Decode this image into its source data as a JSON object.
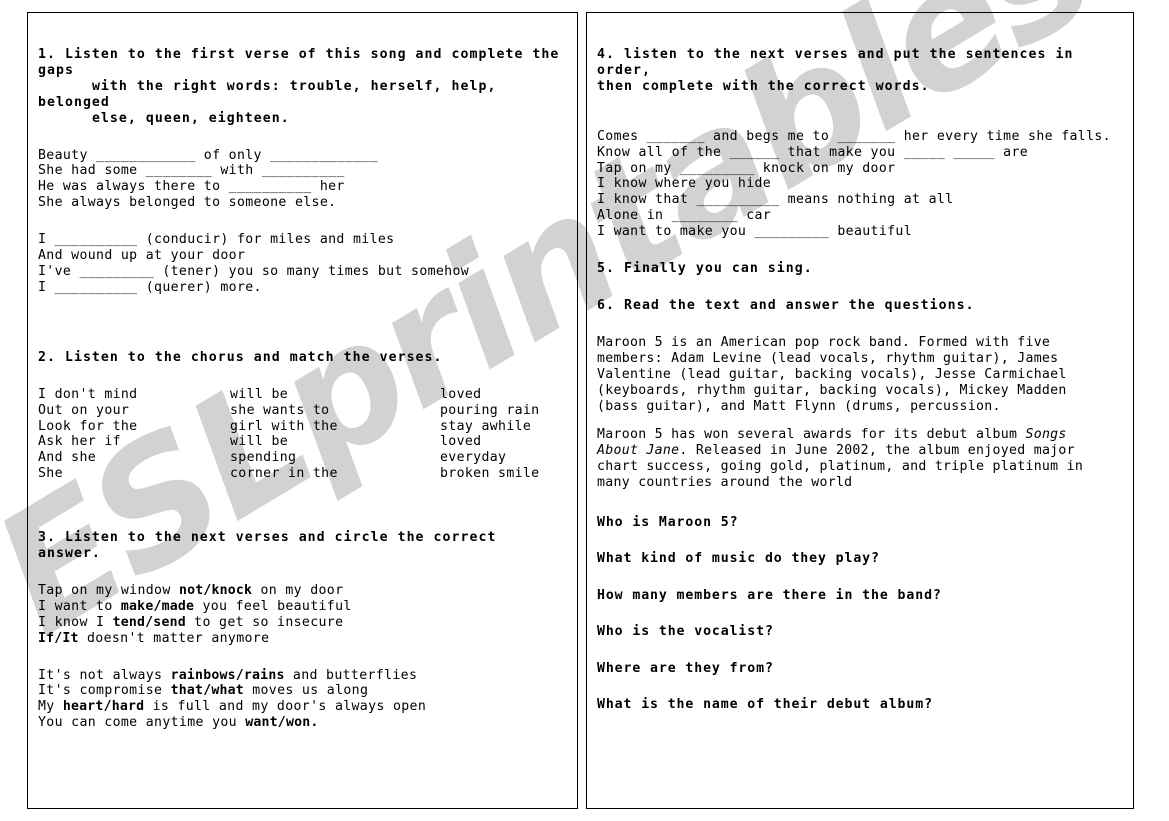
{
  "watermark": {
    "text": "ESLprintables.com",
    "color": "#d2d2d2"
  },
  "left_page": {
    "ex1": {
      "instruction": "1. Listen to the first verse of this song and complete the gaps\n      with the right words: trouble, herself, help, belonged\n      else, queen, eighteen.",
      "verse1": [
        "Beauty ____________ of only _____________",
        "She had some ________ with __________",
        "He was always there to __________ her",
        "She always belonged to someone else."
      ],
      "verse2": [
        "I __________ (conducir) for miles and miles",
        "And wound up at your door",
        "I've _________ (tener) you so many times but somehow",
        "I __________ (querer) more."
      ]
    },
    "ex2": {
      "instruction": "2. Listen to the chorus and match the verses.",
      "columns": [
        "col_a",
        "col_b",
        "col_c"
      ],
      "rows": [
        [
          "I don't mind",
          "will be",
          "loved"
        ],
        [
          "Out on your",
          "she wants to",
          "pouring rain"
        ],
        [
          "Look for the",
          "girl with the",
          "stay awhile"
        ],
        [
          "Ask her if",
          "will be",
          "loved"
        ],
        [
          "And she",
          "spending",
          "everyday"
        ],
        [
          "She",
          "corner in the",
          "broken smile"
        ]
      ]
    },
    "ex3": {
      "instruction": "3. Listen to the next verses and circle the correct answer.",
      "verse1": [
        {
          "pre": "Tap on my window ",
          "bold": "not/knock",
          "post": " on my door"
        },
        {
          "pre": "I want to ",
          "bold": "make/made",
          "post": " you feel beautiful"
        },
        {
          "pre": "I know I ",
          "bold": "tend/send",
          "post": " to get so insecure"
        },
        {
          "pre": "",
          "bold": "If/It",
          "post": " doesn't matter anymore"
        }
      ],
      "verse2": [
        {
          "pre": "It's not always ",
          "bold": "rainbows/rains",
          "post": " and butterflies"
        },
        {
          "pre": "It's compromise ",
          "bold": "that/what",
          "post": " moves us along"
        },
        {
          "pre": "My ",
          "bold": "heart/hard",
          "post": " is full and my door's always open"
        },
        {
          "pre": "You can come anytime you ",
          "bold": "want/won.",
          "post": ""
        }
      ]
    }
  },
  "right_page": {
    "ex4": {
      "instruction": "4. listen to the next verses and put the sentences in order,\nthen complete with the correct words.",
      "lines": [
        "Comes _______ and begs me to _______ her every time she falls.",
        "Know all of the ______ that make you _____ _____ are",
        "Tap on my _________ knock on my door",
        "I know where you hide",
        "I know that __________ means nothing at all",
        "Alone in ________ car",
        "I want to make you _________ beautiful"
      ]
    },
    "ex5": {
      "instruction": "5. Finally you can sing."
    },
    "ex6": {
      "instruction": "6. Read the text and answer the questions.",
      "paragraph1": "Maroon 5 is an American pop rock band. Formed with five members: Adam Levine (lead vocals, rhythm guitar), James Valentine (lead guitar, backing vocals), Jesse Carmichael (keyboards, rhythm guitar, backing vocals), Mickey Madden (bass guitar), and Matt Flynn (drums, percussion.",
      "paragraph2_pre": "Maroon 5 has won several awards for its debut album ",
      "paragraph2_album": "Songs About Jane",
      "paragraph2_post": ". Released in June 2002, the album enjoyed major chart success, going gold, platinum, and triple platinum in many countries around the world",
      "questions": [
        "Who is Maroon 5?",
        "What kind of music do they play?",
        "How many members are there in the band?",
        "Who is the vocalist?",
        "Where are they from?",
        "What is the name of their debut album?"
      ]
    }
  }
}
